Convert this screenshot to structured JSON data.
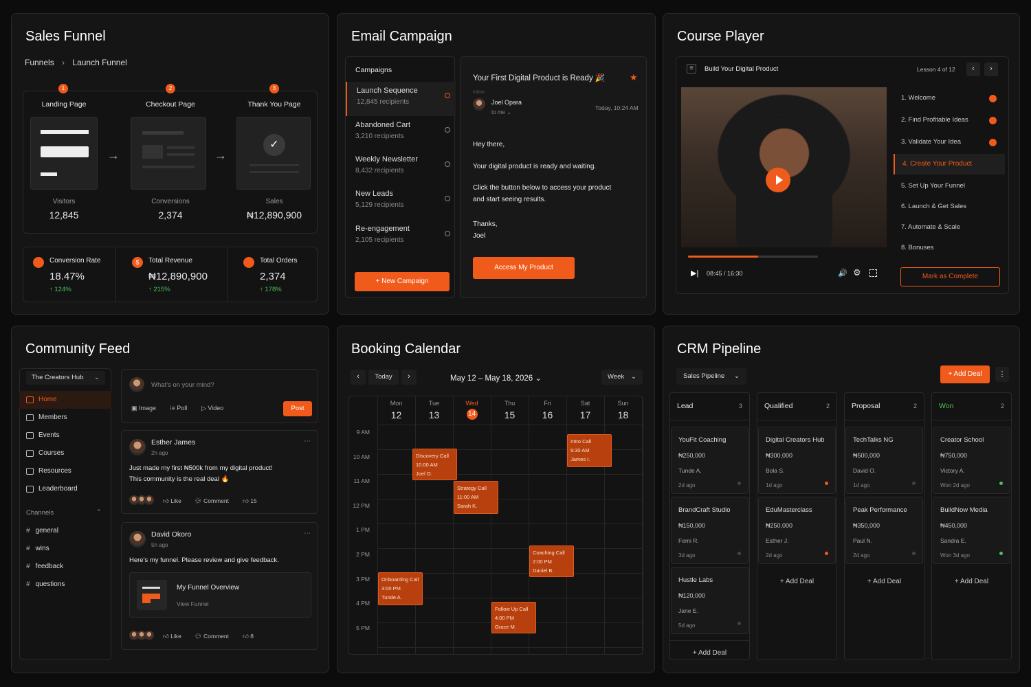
{
  "colors": {
    "accent": "#f05a1a",
    "positive": "#4cc15a",
    "background": "#0c0c0c",
    "panel": "#151515"
  },
  "sales_funnel": {
    "title": "Sales Funnel",
    "breadcrumb": [
      "Funnels",
      "Launch Funnel"
    ],
    "steps": [
      {
        "num": "1",
        "label": "Landing Page",
        "metric_label": "Visitors",
        "metric_value": "12,845"
      },
      {
        "num": "2",
        "label": "Checkout Page",
        "metric_label": "Conversions",
        "metric_value": "2,374"
      },
      {
        "num": "3",
        "label": "Thank You Page",
        "metric_label": "Sales",
        "metric_value": "₦12,890,900"
      }
    ],
    "kpis": [
      {
        "label": "Conversion Rate",
        "value": "18.47%",
        "change": "↑ 124%"
      },
      {
        "label": "Total Revenue",
        "value": "₦12,890,900",
        "change": "↑ 215%"
      },
      {
        "label": "Total Orders",
        "value": "2,374",
        "change": "↑ 178%"
      }
    ]
  },
  "email_campaign": {
    "title": "Email Campaign",
    "campaigns_header": "Campaigns",
    "campaigns": [
      {
        "name": "Launch Sequence",
        "recipients": "12,845 recipients"
      },
      {
        "name": "Abandoned Cart",
        "recipients": "3,210 recipients"
      },
      {
        "name": "Weekly Newsletter",
        "recipients": "8,432 recipients"
      },
      {
        "name": "New Leads",
        "recipients": "5,129 recipients"
      },
      {
        "name": "Re-engagement",
        "recipients": "2,105 recipients"
      }
    ],
    "new_campaign_button": "+ New Campaign",
    "email": {
      "subject": "Your First Digital Product is Ready 🎉",
      "folder": "Inbox",
      "sender": "Joel Opara",
      "to": "to me ⌄",
      "time": "Today, 10:24 AM",
      "greeting": "Hey there,",
      "line1": "Your digital product is ready and waiting.",
      "line2a": "Click the button below to access your product",
      "line2b": "and start seeing results.",
      "signoff": "Thanks,",
      "signature": "Joel",
      "cta": "Access My Product"
    }
  },
  "course_player": {
    "title": "Course Player",
    "course_name": "Build Your Digital Product",
    "lesson_counter": "Lesson 4 of 12",
    "time": "08:45 / 16:30",
    "progress": 0.54,
    "lessons": [
      {
        "label": "1. Welcome",
        "done": true
      },
      {
        "label": "2. Find Profitable Ideas",
        "done": true
      },
      {
        "label": "3. Validate Your Idea",
        "done": true
      },
      {
        "label": "4. Create Your Product",
        "active": true
      },
      {
        "label": "5. Set Up Your Funnel"
      },
      {
        "label": "6. Launch & Get Sales"
      },
      {
        "label": "7. Automate & Scale"
      },
      {
        "label": "8. Bonuses"
      }
    ],
    "mark_complete": "Mark as Complete"
  },
  "community": {
    "title": "Community Feed",
    "hub": "The Creators Hub",
    "nav": [
      "Home",
      "Members",
      "Events",
      "Courses",
      "Resources",
      "Leaderboard"
    ],
    "channels_header": "Channels",
    "channels": [
      "general",
      "wins",
      "feedback",
      "questions"
    ],
    "composer_placeholder": "What's on your mind?",
    "composer_actions": [
      "Image",
      "Poll",
      "Video"
    ],
    "post_button": "Post",
    "posts": [
      {
        "author": "Esther James",
        "time": "2h ago",
        "text1": "Just made my first ₦500k from my digital product!",
        "text2": "This community is the real deal 🔥",
        "like": "Like",
        "comment": "Comment",
        "count": "15"
      },
      {
        "author": "David Okoro",
        "time": "5h ago",
        "text1": "Here's my funnel. Please review and give feedback.",
        "attach_title": "My Funnel Overview",
        "attach_sub": "View Funnel",
        "like": "Like",
        "comment": "Comment",
        "count": "8"
      }
    ]
  },
  "booking": {
    "title": "Booking Calendar",
    "today": "Today",
    "range": "May 12 – May 18, 2026 ⌄",
    "view": "Week",
    "days": [
      {
        "name": "Mon",
        "num": "12"
      },
      {
        "name": "Tue",
        "num": "13"
      },
      {
        "name": "Wed",
        "num": "14",
        "today": true
      },
      {
        "name": "Thu",
        "num": "15"
      },
      {
        "name": "Fri",
        "num": "16"
      },
      {
        "name": "Sat",
        "num": "17"
      },
      {
        "name": "Sun",
        "num": "18"
      }
    ],
    "times": [
      "9 AM",
      "10 AM",
      "11 AM",
      "12 PM",
      "1 PM",
      "2 PM",
      "3 PM",
      "4 PM",
      "5 PM"
    ],
    "events": [
      {
        "title": "Discovery Call",
        "time": "10:00 AM",
        "who": "Joel O."
      },
      {
        "title": "Strategy Call",
        "time": "11:00 AM",
        "who": "Sarah K."
      },
      {
        "title": "Intro Call",
        "time": "9:30 AM",
        "who": "James I."
      },
      {
        "title": "Coaching Call",
        "time": "2:00 PM",
        "who": "Daniel B."
      },
      {
        "title": "Onboarding Call",
        "time": "3:00 PM",
        "who": "Tunde A."
      },
      {
        "title": "Follow Up Call",
        "time": "4:00 PM",
        "who": "Grace M."
      }
    ]
  },
  "crm": {
    "title": "CRM Pipeline",
    "pipeline": "Sales Pipeline",
    "add_deal_button": "+ Add Deal",
    "add_deal": "+ Add Deal",
    "columns": [
      {
        "name": "Lead",
        "count": "3",
        "deals": [
          {
            "name": "YouFit Coaching",
            "value": "₦250,000",
            "person": "Tunde A.",
            "age": "2d ago"
          },
          {
            "name": "BrandCraft Studio",
            "value": "₦150,000",
            "person": "Femi R.",
            "age": "3d ago"
          },
          {
            "name": "Hustle Labs",
            "value": "₦120,000",
            "person": "Jane E.",
            "age": "5d ago"
          }
        ]
      },
      {
        "name": "Qualified",
        "count": "2",
        "deals": [
          {
            "name": "Digital Creators Hub",
            "value": "₦300,000",
            "person": "Bola S.",
            "age": "1d ago"
          },
          {
            "name": "EduMasterclass",
            "value": "₦250,000",
            "person": "Esther J.",
            "age": "2d ago"
          }
        ]
      },
      {
        "name": "Proposal",
        "count": "2",
        "deals": [
          {
            "name": "TechTalks NG",
            "value": "₦500,000",
            "person": "David O.",
            "age": "1d ago"
          },
          {
            "name": "Peak Performance",
            "value": "₦350,000",
            "person": "Paul N.",
            "age": "2d ago"
          }
        ]
      },
      {
        "name": "Won",
        "count": "2",
        "deals": [
          {
            "name": "Creator School",
            "value": "₦750,000",
            "person": "Victory A.",
            "age": "Won 2d ago"
          },
          {
            "name": "BuildNow Media",
            "value": "₦450,000",
            "person": "Sandra E.",
            "age": "Won 3d ago"
          }
        ]
      }
    ]
  }
}
